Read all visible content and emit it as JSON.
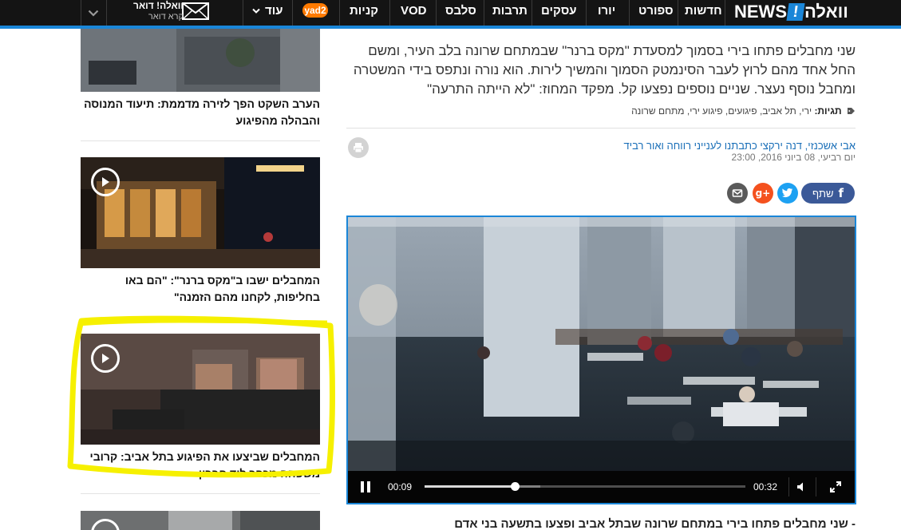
{
  "nav": {
    "logo_walla": "וואלה",
    "logo_bang": "!",
    "logo_news": "NEWS",
    "items": [
      "חדשות",
      "ספורט",
      "יורו",
      "עסקים",
      "תרבות",
      "סלבס",
      "VOD",
      "קניות"
    ],
    "yad2": "yad2",
    "more": "עוד",
    "mail_title": "וואלה! דואר",
    "mail_subtitle": "קרא דואר"
  },
  "article": {
    "summary": "שני מחבלים פתחו בירי בסמוך למסעדת \"מקס ברנר\" שבמתחם שרונה בלב העיר, ומשם החל אחד מהם לרוץ לעבר הסינמטק הסמוך והמשיך לירות. הוא נורה ונתפס בידי המשטרה ומחבל נוסף נעצר. שניים נוספים נפצעו קל. מפקד המחוז: \"לא הייתה התרעה\"",
    "tags_label": "תגיות:",
    "tags": "ירי, תל אביב, פיגועים, פיגוע ירי, מתחם שרונה",
    "byline": "אבי אשכנזי, דנה ירקצי כתבתנו לענייני רווחה ואור רביד",
    "date": "יום רביעי, 08 ביוני 2016, 23:00",
    "share_label": "שתף",
    "bottom_text": "- שני מחבלים פתחו בירי במתחם שרונה שבתל אביב ופצעו בתשעה בני אדם"
  },
  "video": {
    "current_time": "00:09",
    "duration": "00:32",
    "progress": 0.28,
    "buffered": 0.36
  },
  "sidebar": {
    "items": [
      {
        "caption": "הערב השקט הפך לזירה מדממת: תיעוד המנוסה והבהלה מהפיגוע"
      },
      {
        "caption": "המחבלים ישבו ב\"מקס ברנר\": \"הם באו בחליפות, לקחנו מהם הזמנה\""
      },
      {
        "caption": "המחבלים שביצעו את הפיגוע בתל אביב: קרובי משפחה מכפר ליד חברון"
      }
    ]
  },
  "colors": {
    "accent_blue": "#1a86d8",
    "highlight_yellow": "#f6f000",
    "facebook": "#3b5998",
    "twitter": "#1da1f2",
    "google_plus": "#f4511e",
    "mail": "#5a5a5a"
  }
}
